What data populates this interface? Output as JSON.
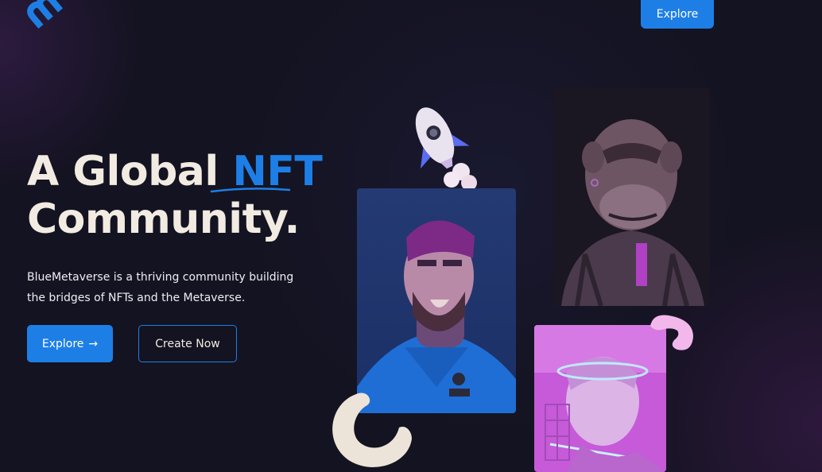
{
  "nav": {
    "explore_label": "Explore"
  },
  "hero": {
    "title_part1": "A Global",
    "title_accent": "NFT",
    "title_part2": "Community.",
    "description": "BlueMetaverse is a thriving community building the bridges of NFTs and the Metaverse.",
    "primary_button": "Explore",
    "primary_button_icon": "→",
    "secondary_button": "Create Now"
  },
  "colors": {
    "accent": "#1d7fe6",
    "background": "#141321",
    "heading": "#f1ebe2"
  },
  "icons": [
    "logo-icon",
    "arrow-right-icon",
    "rocket-icon",
    "ring-icon"
  ]
}
